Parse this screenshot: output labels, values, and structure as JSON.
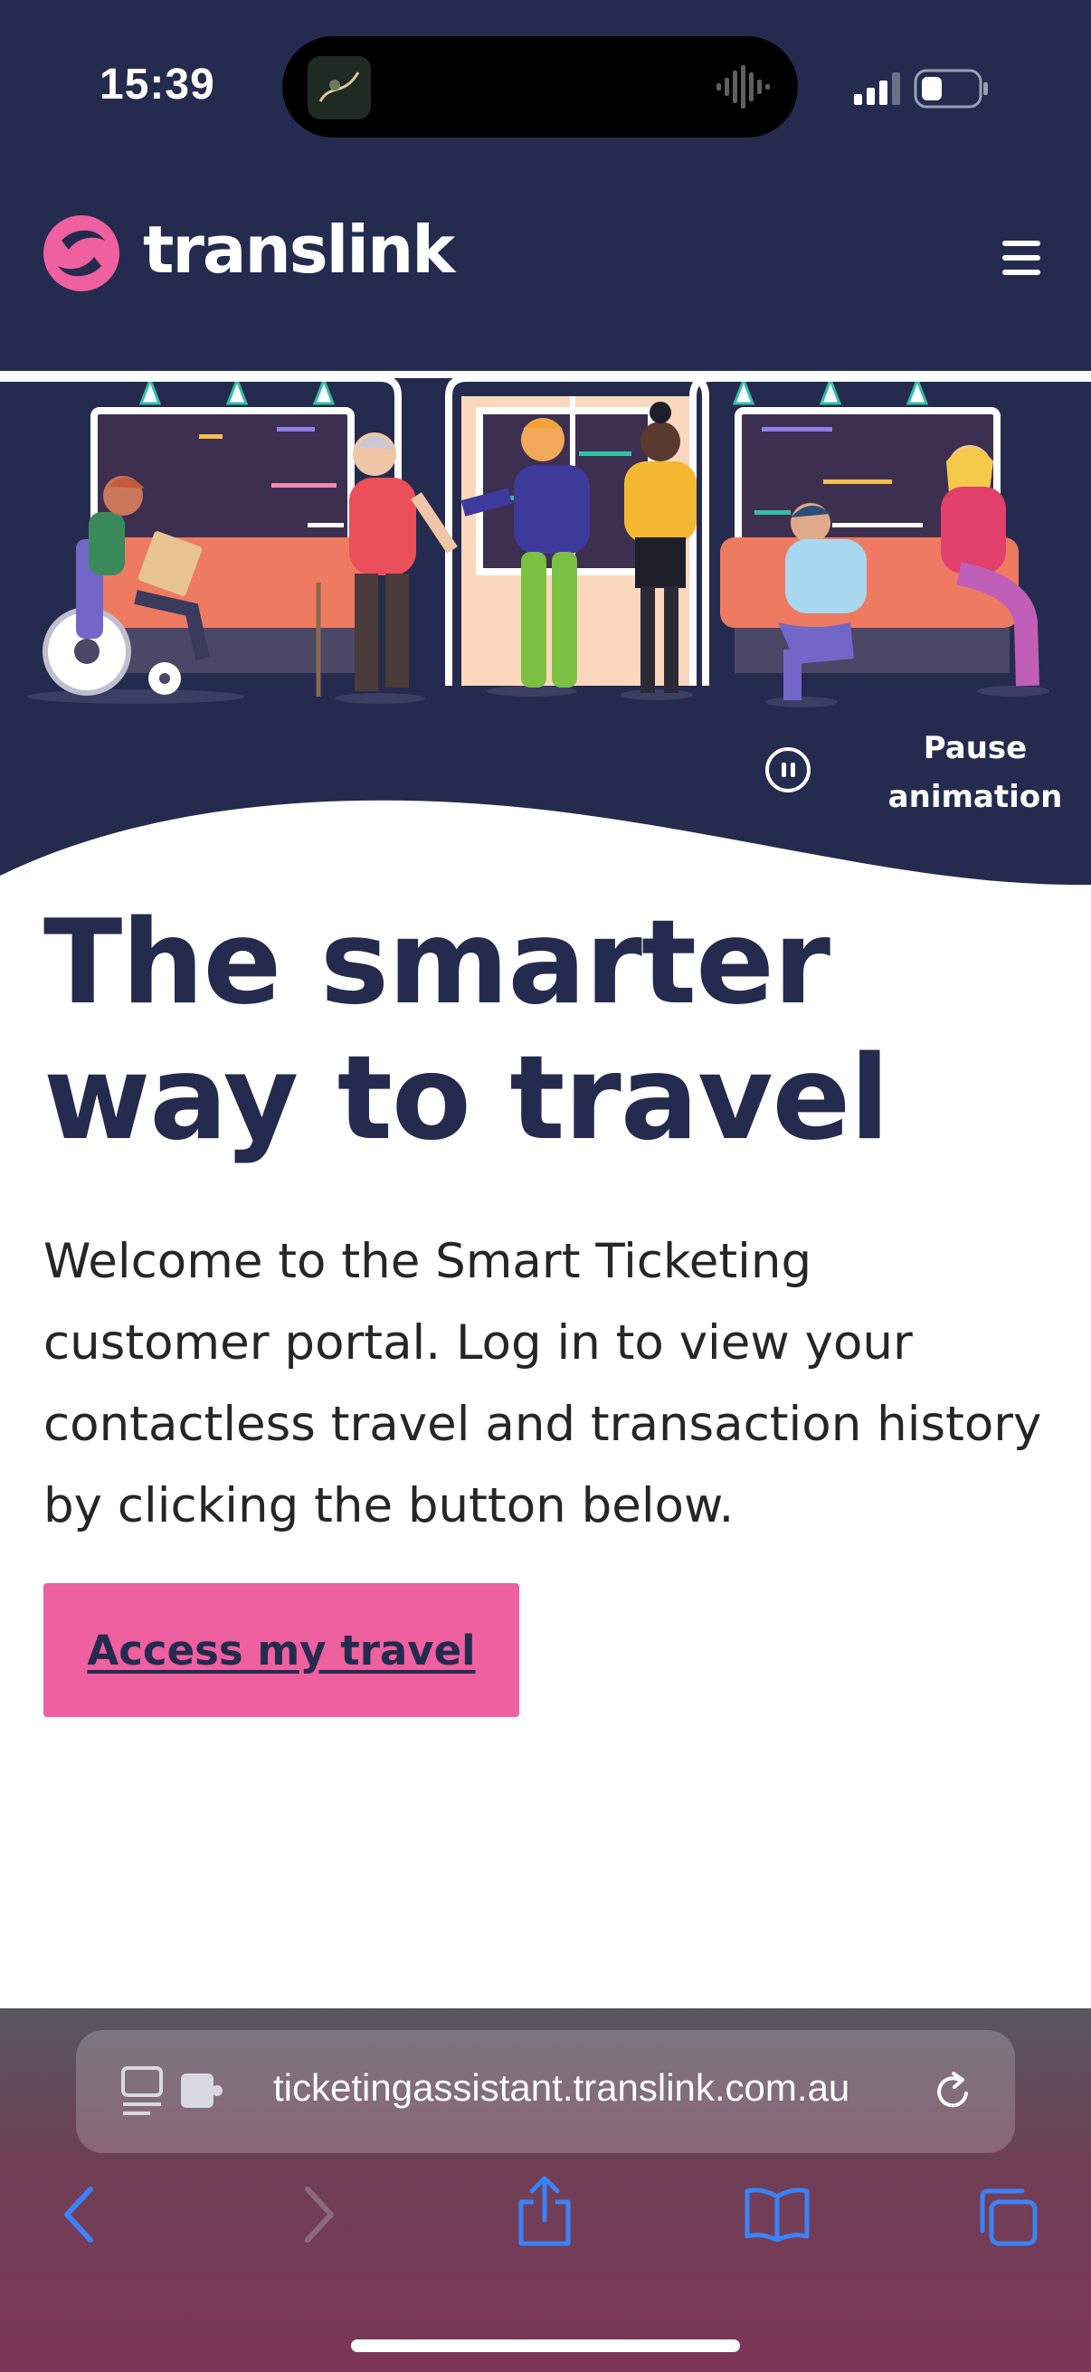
{
  "status_bar": {
    "time": "15:39"
  },
  "header": {
    "brand": "translink",
    "menu_icon": "hamburger-menu-icon",
    "logo_color": "#ee609f",
    "background": "#252b4e"
  },
  "hero": {
    "pause_label": "Pause\nanimation"
  },
  "main": {
    "headline": "The smarter way to travel",
    "intro": "Welcome to the Smart Ticketing customer portal. Log in to view your contactless travel and transaction history by clicking the button below.",
    "cta_label": "Access my travel",
    "cta_color": "#ee609f"
  },
  "browser": {
    "url": "ticketingassistant.translink.com.au",
    "toolbar": [
      "back-icon",
      "forward-icon",
      "share-icon",
      "bookmarks-icon",
      "tabs-icon"
    ]
  }
}
